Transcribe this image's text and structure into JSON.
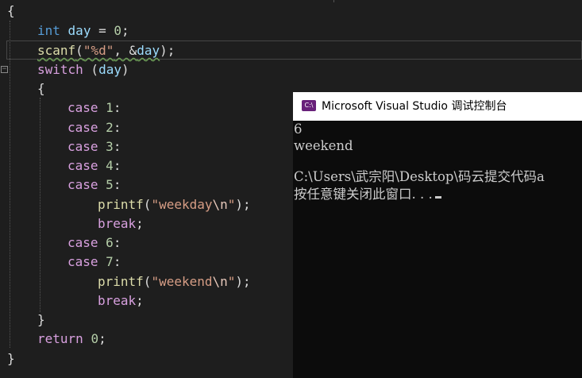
{
  "editor": {
    "lines": {
      "open_brace": "{",
      "l1": {
        "kw": "int",
        "var": "day",
        "eq": " = ",
        "num": "0",
        "end": ";"
      },
      "l2": {
        "fn": "scanf",
        "p1": "(",
        "str": "\"%d\"",
        "sep": ", &",
        "var": "day",
        "end": ");"
      },
      "l3": {
        "kw": "switch",
        "p1": " (",
        "var": "day",
        "p2": ")"
      },
      "l4": "{",
      "cases": [
        {
          "kw": "case",
          "num": "1",
          "colon": ":"
        },
        {
          "kw": "case",
          "num": "2",
          "colon": ":"
        },
        {
          "kw": "case",
          "num": "3",
          "colon": ":"
        },
        {
          "kw": "case",
          "num": "4",
          "colon": ":"
        },
        {
          "kw": "case",
          "num": "5",
          "colon": ":"
        }
      ],
      "printf1": {
        "fn": "printf",
        "p1": "(",
        "str_a": "\"weekday",
        "esc": "\\n",
        "str_b": "\"",
        "end": ");"
      },
      "break1": {
        "kw": "break",
        "end": ";"
      },
      "cases2": [
        {
          "kw": "case",
          "num": "6",
          "colon": ":"
        },
        {
          "kw": "case",
          "num": "7",
          "colon": ":"
        }
      ],
      "printf2": {
        "fn": "printf",
        "p1": "(",
        "str_a": "\"weekend",
        "esc": "\\n",
        "str_b": "\"",
        "end": ");"
      },
      "break2": {
        "kw": "break",
        "end": ";"
      },
      "close_switch": "}",
      "ret": {
        "kw": "return",
        "num": "0",
        "end": ";"
      },
      "close_brace": "}"
    },
    "fold_glyph": "−"
  },
  "console": {
    "icon_text": "C:\\",
    "title": "Microsoft Visual Studio 调试控制台",
    "lines": [
      "6",
      "weekend",
      "",
      "C:\\Users\\武宗阳\\Desktop\\码云提交代码a",
      "按任意键关闭此窗口. . ."
    ]
  },
  "colors": {
    "editor_bg": "#1e1e1e",
    "console_bg": "#0c0c0c",
    "keyword": "#569cd6",
    "control_keyword": "#d8a0df",
    "function": "#dcdcaa",
    "variable": "#9cdcfe",
    "number": "#b5cea8",
    "string": "#d69d85"
  }
}
